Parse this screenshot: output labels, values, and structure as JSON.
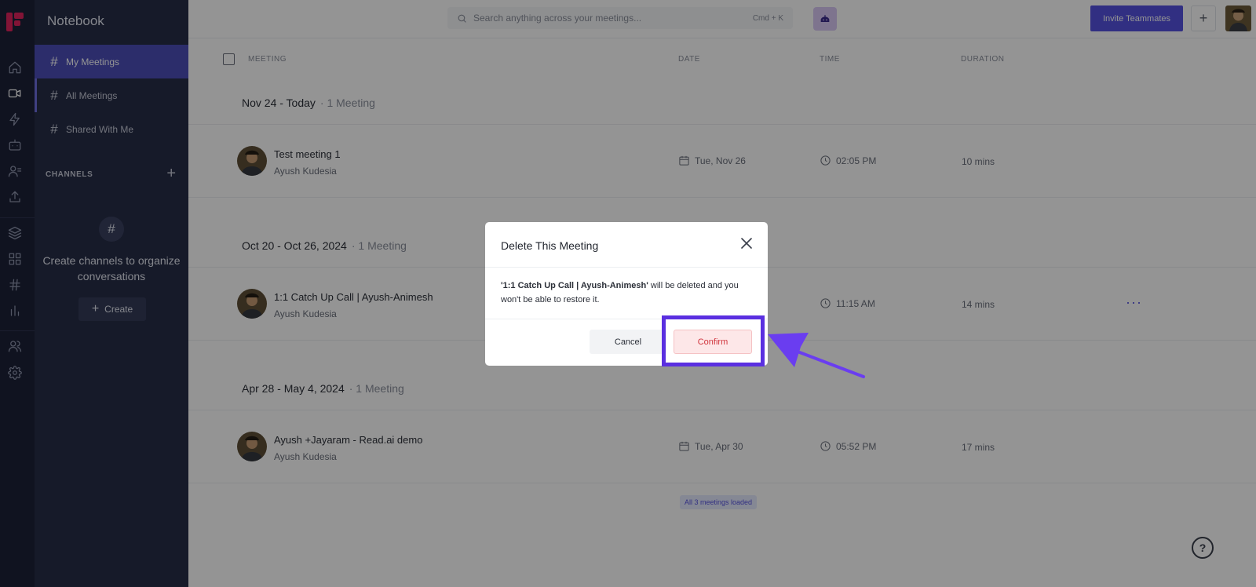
{
  "app": {
    "title": "Notebook"
  },
  "sidebar": {
    "items": [
      {
        "label": "My Meetings"
      },
      {
        "label": "All Meetings"
      },
      {
        "label": "Shared With Me"
      }
    ],
    "channels_label": "CHANNELS",
    "empty_text": "Create channels to organize conversations",
    "create_label": "Create"
  },
  "topbar": {
    "search_placeholder": "Search anything across your meetings...",
    "search_shortcut": "Cmd + K",
    "invite_label": "Invite Teammates",
    "plus_label": "+"
  },
  "table": {
    "headers": {
      "meeting": "MEETING",
      "date": "DATE",
      "time": "TIME",
      "duration": "DURATION"
    },
    "groups": [
      {
        "title": "Nov 24 - Today",
        "count": "· 1 Meeting",
        "meetings": [
          {
            "title": "Test meeting 1",
            "owner": "Ayush Kudesia",
            "date": "Tue, Nov 26",
            "time": "02:05 PM",
            "duration": "10 mins"
          }
        ]
      },
      {
        "title": "Oct 20 - Oct 26, 2024",
        "count": "· 1 Meeting",
        "meetings": [
          {
            "title": "1:1 Catch Up Call | Ayush-Animesh",
            "owner": "Ayush Kudesia",
            "date": "",
            "time": "11:15 AM",
            "duration": "14 mins"
          }
        ]
      },
      {
        "title": "Apr 28 - May 4, 2024",
        "count": "· 1 Meeting",
        "meetings": [
          {
            "title": "Ayush +Jayaram - Read.ai demo",
            "owner": "Ayush Kudesia",
            "date": "Tue, Apr 30",
            "time": "05:52 PM",
            "duration": "17 mins"
          }
        ]
      }
    ],
    "more_label": "···",
    "loaded_label": "All 3 meetings loaded"
  },
  "help": {
    "label": "?"
  },
  "modal": {
    "title": "Delete This Meeting",
    "body_bold": "'1:1 Catch Up Call | Ayush-Animesh'",
    "body_rest": " will be deleted and you won't be able to restore it.",
    "cancel_label": "Cancel",
    "confirm_label": "Confirm"
  },
  "colors": {
    "accent": "#5552e0",
    "highlight": "#5a2fe0",
    "danger": "#d0353d",
    "rail_bg": "#1d2238",
    "sidebar_bg": "#272d47"
  }
}
